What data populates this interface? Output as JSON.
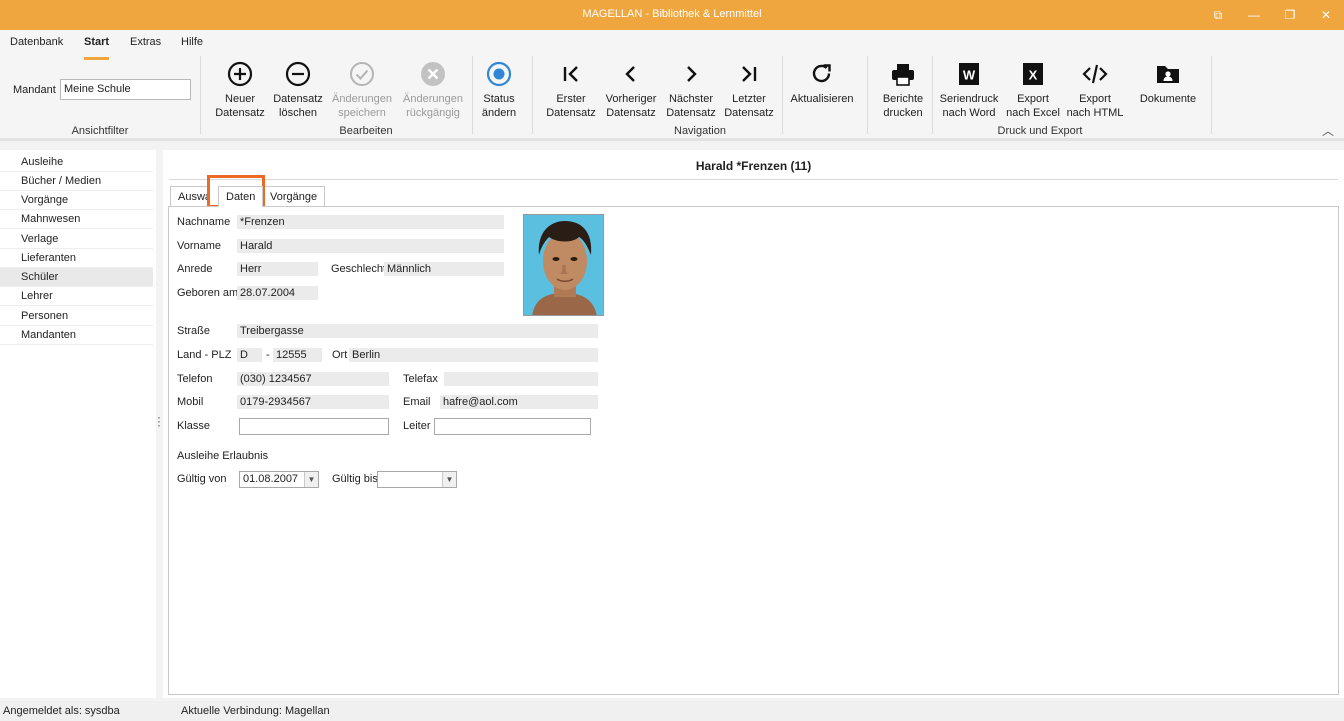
{
  "window": {
    "title": "MAGELLAN - Bibliothek & Lernmittel",
    "buttons": {
      "restore_label": "⧉",
      "minimize_label": "—",
      "maximize_label": "❐",
      "close_label": "✕"
    }
  },
  "menu": {
    "items": [
      "Datenbank",
      "Start",
      "Extras",
      "Hilfe"
    ]
  },
  "ribbon": {
    "mandant_label": "Mandant",
    "mandant_value": "Meine Schule",
    "groups": {
      "ansichtfilter": "Ansichtfilter",
      "bearbeiten": "Bearbeiten",
      "navigation": "Navigation",
      "druck_export": "Druck und Export"
    },
    "buttons": {
      "neuer": [
        "Neuer",
        "Datensatz"
      ],
      "loeschen": [
        "Datensatz",
        "löschen"
      ],
      "speichern": [
        "Änderungen",
        "speichern"
      ],
      "rueckgaengig": [
        "Änderungen",
        "rückgängig"
      ],
      "status": [
        "Status",
        "ändern"
      ],
      "erster": [
        "Erster",
        "Datensatz"
      ],
      "vorheriger": [
        "Vorheriger",
        "Datensatz"
      ],
      "naechster": [
        "Nächster",
        "Datensatz"
      ],
      "letzter": [
        "Letzter",
        "Datensatz"
      ],
      "aktualisieren": [
        "Aktualisieren",
        ""
      ],
      "berichte": [
        "Berichte",
        "drucken"
      ],
      "seriendruck": [
        "Seriendruck",
        "nach Word"
      ],
      "excel": [
        "Export",
        "nach Excel"
      ],
      "html": [
        "Export",
        "nach HTML"
      ],
      "dokumente": [
        "Dokumente",
        ""
      ]
    },
    "collapse_icon": "︿"
  },
  "sidebar": {
    "items": [
      "Ausleihe",
      "Bücher / Medien",
      "Vorgänge",
      "Mahnwesen",
      "Verlage",
      "Lieferanten",
      "Schüler",
      "Lehrer",
      "Personen",
      "Mandanten"
    ],
    "selected": "Schüler"
  },
  "record": {
    "title": "Harald *Frenzen (11)",
    "tabs": [
      "Auswahl",
      "Daten",
      "Vorgänge"
    ],
    "fields": {
      "nachname": {
        "label": "Nachname",
        "value": "*Frenzen"
      },
      "vorname": {
        "label": "Vorname",
        "value": "Harald"
      },
      "anrede": {
        "label": "Anrede",
        "value": "Herr"
      },
      "geschlecht": {
        "label": "Geschlecht",
        "value": "Männlich"
      },
      "geboren": {
        "label": "Geboren am",
        "value": "28.07.2004"
      },
      "strasse": {
        "label": "Straße",
        "value": "Treibergasse"
      },
      "land_plz": {
        "label": "Land - PLZ",
        "land": "D",
        "dash": "-",
        "plz": "12555"
      },
      "ort": {
        "label": "Ort",
        "value": "Berlin"
      },
      "telefon": {
        "label": "Telefon",
        "value": "(030) 1234567"
      },
      "telefax": {
        "label": "Telefax",
        "value": ""
      },
      "mobil": {
        "label": "Mobil",
        "value": "0179-2934567"
      },
      "email": {
        "label": "Email",
        "value": "hafre@aol.com"
      },
      "klasse": {
        "label": "Klasse",
        "value": ""
      },
      "leiter": {
        "label": "Leiter",
        "value": ""
      },
      "ausleihe_erlaubnis": {
        "label": "Ausleihe Erlaubnis"
      },
      "gueltig_von": {
        "label": "Gültig von",
        "value": "01.08.2007"
      },
      "gueltig_bis": {
        "label": "Gültig bis",
        "value": ""
      }
    }
  },
  "status": {
    "user": "Angemeldet als: sysdba",
    "connection": "Aktuelle Verbindung: Magellan"
  },
  "colors": {
    "accent": "#f0a63e",
    "tab_highlight": "#ed6a24",
    "status_blue": "#2f86d6"
  }
}
